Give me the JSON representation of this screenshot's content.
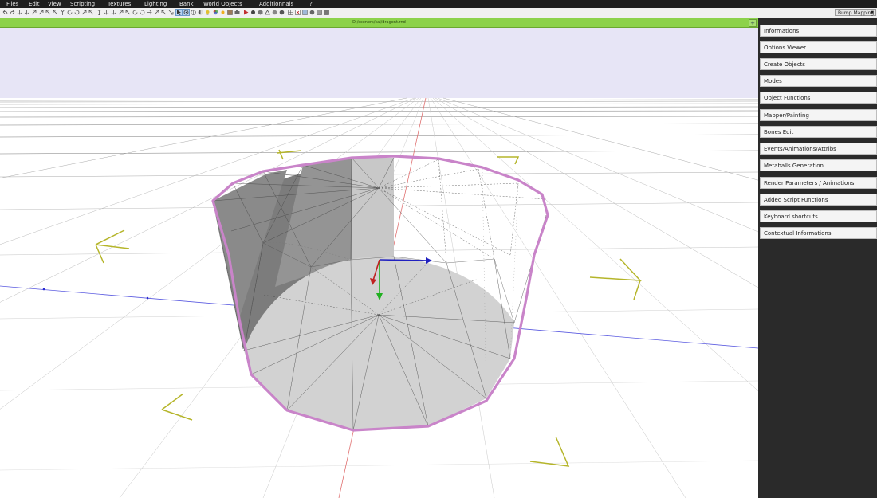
{
  "menu": {
    "items": [
      "Files",
      "Edit",
      "View",
      "Scripting",
      "Textures",
      "Lighting",
      "Bank",
      "World Objects",
      "Additionnals",
      "?"
    ]
  },
  "toolbar": {
    "render_mode": "Bump Mapping"
  },
  "viewport": {
    "file_path": "D:/sceners/cal/dragont.rnd"
  },
  "panel": {
    "items": [
      "Informations",
      "Options Viewer",
      "Create Objects",
      "Modes",
      "Object Functions",
      "Mapper/Painting",
      "Bones Edit",
      "Events/Animations/Attribs",
      "Metaballs Generation",
      "Render Parameters / Animations",
      "Added Script Functions",
      "Keyboard shortcuts",
      "Contextual Informations"
    ]
  },
  "colors": {
    "sky": "#e7e5f6",
    "selection": "#c984c9",
    "title_bar": "#8cd24a",
    "sidebar_bg": "#2a2a2a",
    "guide_arrows": "#b5b52a"
  }
}
